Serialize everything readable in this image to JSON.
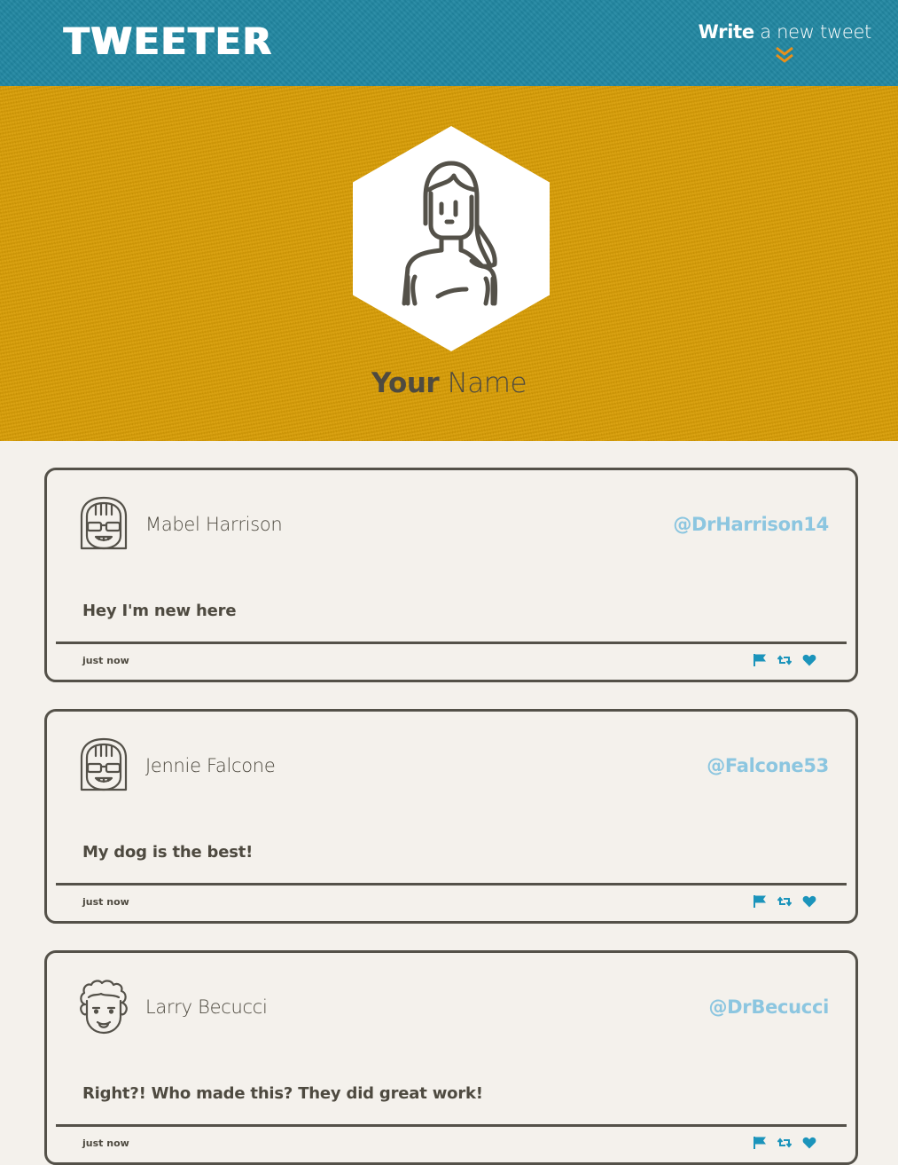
{
  "nav": {
    "logo": "TWEETER",
    "compose_bold": "Write",
    "compose_rest": " a new tweet",
    "compose_icon": "double-chevron-down-icon"
  },
  "profile": {
    "first_name": "Your",
    "last_name": " Name",
    "avatar_icon": "woman-avatar-icon"
  },
  "colors": {
    "nav_bg": "#2187a2",
    "header_bg": "#d89d05",
    "page_bg": "#f4f1ec",
    "accent_orange": "#e8901a",
    "handle_blue": "#8cc6e0",
    "icon_teal": "#1b94bb",
    "border_dark": "#545149"
  },
  "tweets": [
    {
      "author": "Mabel Harrison",
      "handle": "@DrHarrison14",
      "content": "Hey I'm new here",
      "time": "just now",
      "avatar_icon": "girl-sunglasses-avatar-icon"
    },
    {
      "author": "Jennie Falcone",
      "handle": "@Falcone53",
      "content": "My dog is the best!",
      "time": "just now",
      "avatar_icon": "girl-sunglasses-avatar-icon"
    },
    {
      "author": "Larry Becucci",
      "handle": "@DrBecucci",
      "content": "Right?! Who made this? They did great work!",
      "time": "just now",
      "avatar_icon": "curly-hair-man-avatar-icon"
    }
  ],
  "actions": [
    "flag-icon",
    "retweet-icon",
    "heart-icon"
  ]
}
